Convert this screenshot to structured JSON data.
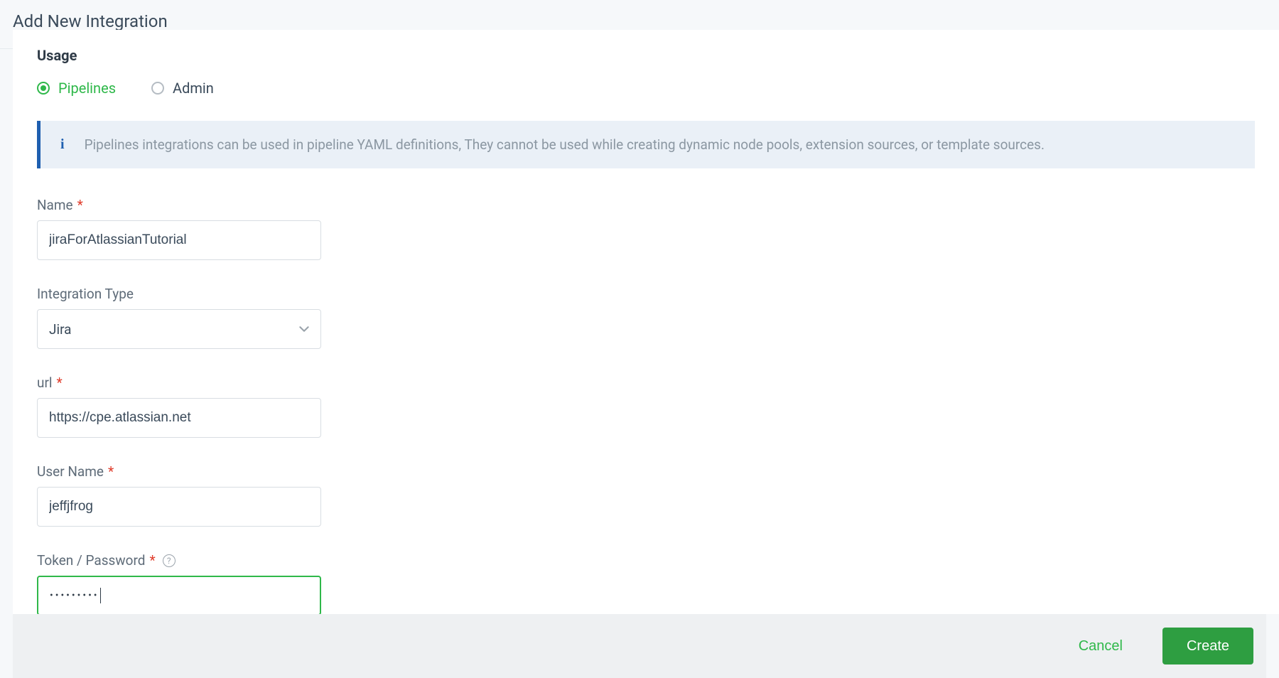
{
  "page_title": "Add New Integration",
  "section_title": "Usage",
  "usage_options": {
    "pipelines": "Pipelines",
    "admin": "Admin",
    "selected": "pipelines"
  },
  "info_banner": "Pipelines integrations can be used in pipeline YAML definitions, They cannot be used while creating dynamic node pools, extension sources, or template sources.",
  "fields": {
    "name": {
      "label": "Name",
      "value": "jiraForAtlassianTutorial",
      "required": true
    },
    "type": {
      "label": "Integration Type",
      "value": "Jira",
      "required": false
    },
    "url": {
      "label": "url",
      "value": "https://cpe.atlassian.net",
      "required": true
    },
    "username": {
      "label": "User Name",
      "value": "jeffjfrog",
      "required": true
    },
    "password": {
      "label": "Token / Password",
      "value": "•••••••••",
      "required": true
    }
  },
  "buttons": {
    "cancel": "Cancel",
    "create": "Create"
  }
}
